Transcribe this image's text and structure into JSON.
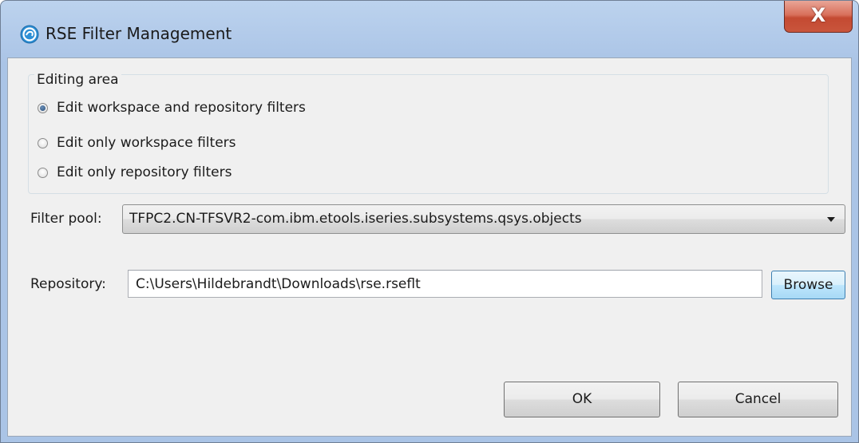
{
  "window": {
    "title": "RSE Filter Management",
    "close_label": "X"
  },
  "editing_area": {
    "legend": "Editing area",
    "options": [
      {
        "label": "Edit workspace and repository filters",
        "checked": true
      },
      {
        "label": "Edit only workspace filters",
        "checked": false
      },
      {
        "label": "Edit only repository filters",
        "checked": false
      }
    ]
  },
  "filter_pool": {
    "label": "Filter pool:",
    "selected": "TFPC2.CN-TFSVR2-com.ibm.etools.iseries.subsystems.qsys.objects"
  },
  "repository": {
    "label": "Repository:",
    "value": "C:\\Users\\Hildebrandt\\Downloads\\rse.rseflt",
    "browse_label": "Browse"
  },
  "buttons": {
    "ok_label": "OK",
    "cancel_label": "Cancel"
  },
  "colors": {
    "title_bar": "#b3cbea",
    "close_button": "#c44a32",
    "dialog_background": "#f0f0f0",
    "browse_highlight": "#3c7fb1"
  },
  "icons": {
    "app": "rse-app-icon",
    "close": "close-icon",
    "dropdown": "chevron-down-icon"
  }
}
